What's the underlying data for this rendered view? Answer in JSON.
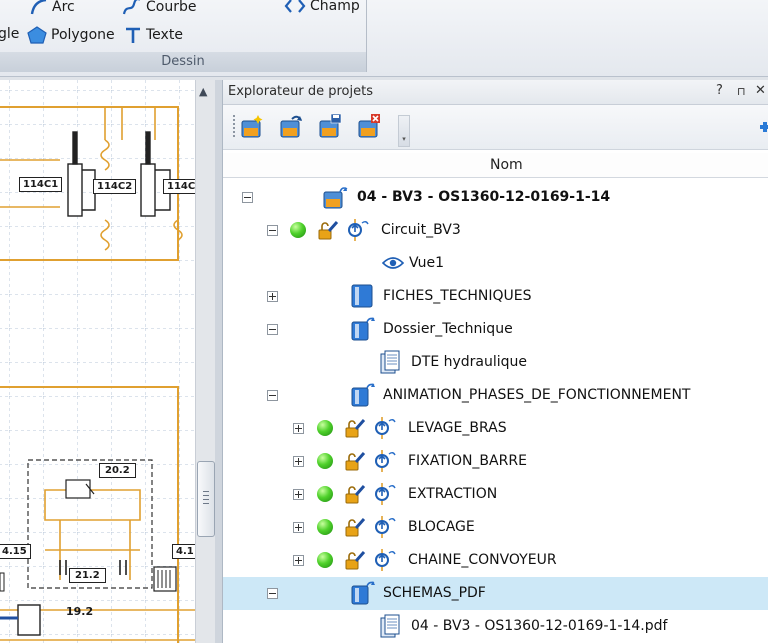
{
  "ribbon": {
    "buttons": [
      {
        "label": "Arc",
        "icon": "arc-icon"
      },
      {
        "label": "Courbe",
        "icon": "curve-icon"
      },
      {
        "label": "Champ",
        "icon": "field-icon"
      },
      {
        "label": "gle",
        "icon": "rectangle-icon"
      },
      {
        "label": "Polygone",
        "icon": "polygon-icon"
      },
      {
        "label": "Texte",
        "icon": "text-icon"
      }
    ],
    "group_caption": "Dessin"
  },
  "canvas": {
    "components": [
      "114C1",
      "114C2",
      "114C",
      "20.2",
      "21.2",
      "19.2",
      "4.15",
      "4.1"
    ]
  },
  "explorer": {
    "title": "Explorateur de projets",
    "controls": [
      "?",
      "⊓",
      "✕"
    ],
    "column_header": "Nom",
    "tree": [
      {
        "label": "04 - BV3 - OS1360-12-0169-1-14",
        "toggle": "minus",
        "icon": "project-icon"
      },
      {
        "label": "Circuit_BV3",
        "toggle": "minus",
        "icon": "circuit-icon",
        "status": "green"
      },
      {
        "label": "Vue1",
        "icon": "eye-icon"
      },
      {
        "label": "FICHES_TECHNIQUES",
        "toggle": "plus",
        "icon": "folder-doc-icon"
      },
      {
        "label": "Dossier_Technique",
        "toggle": "minus",
        "icon": "folder-doc-icon"
      },
      {
        "label": "DTE  hydraulique",
        "icon": "document-icon"
      },
      {
        "label": "ANIMATION_PHASES_DE_FONCTIONNEMENT",
        "toggle": "minus",
        "icon": "folder-doc-icon"
      },
      {
        "label": "LEVAGE_BRAS",
        "toggle": "plus",
        "icon": "circuit-icon",
        "status": "green"
      },
      {
        "label": "FIXATION_BARRE",
        "toggle": "plus",
        "icon": "circuit-icon",
        "status": "green"
      },
      {
        "label": "EXTRACTION",
        "toggle": "plus",
        "icon": "circuit-icon",
        "status": "green"
      },
      {
        "label": "BLOCAGE",
        "toggle": "plus",
        "icon": "circuit-icon",
        "status": "green"
      },
      {
        "label": "CHAINE_CONVOYEUR",
        "toggle": "plus",
        "icon": "circuit-icon",
        "status": "green"
      },
      {
        "label": "SCHEMAS_PDF",
        "toggle": "minus",
        "icon": "folder-doc-icon",
        "selected": true
      },
      {
        "label": "04 - BV3 - OS1360-12-0169-1-14.pdf",
        "icon": "document-icon"
      }
    ]
  },
  "colors": {
    "accent": "#1f6fc1",
    "selection": "#cde8f7",
    "wire": "#e0a030",
    "status_ok": "#4fd12b"
  }
}
